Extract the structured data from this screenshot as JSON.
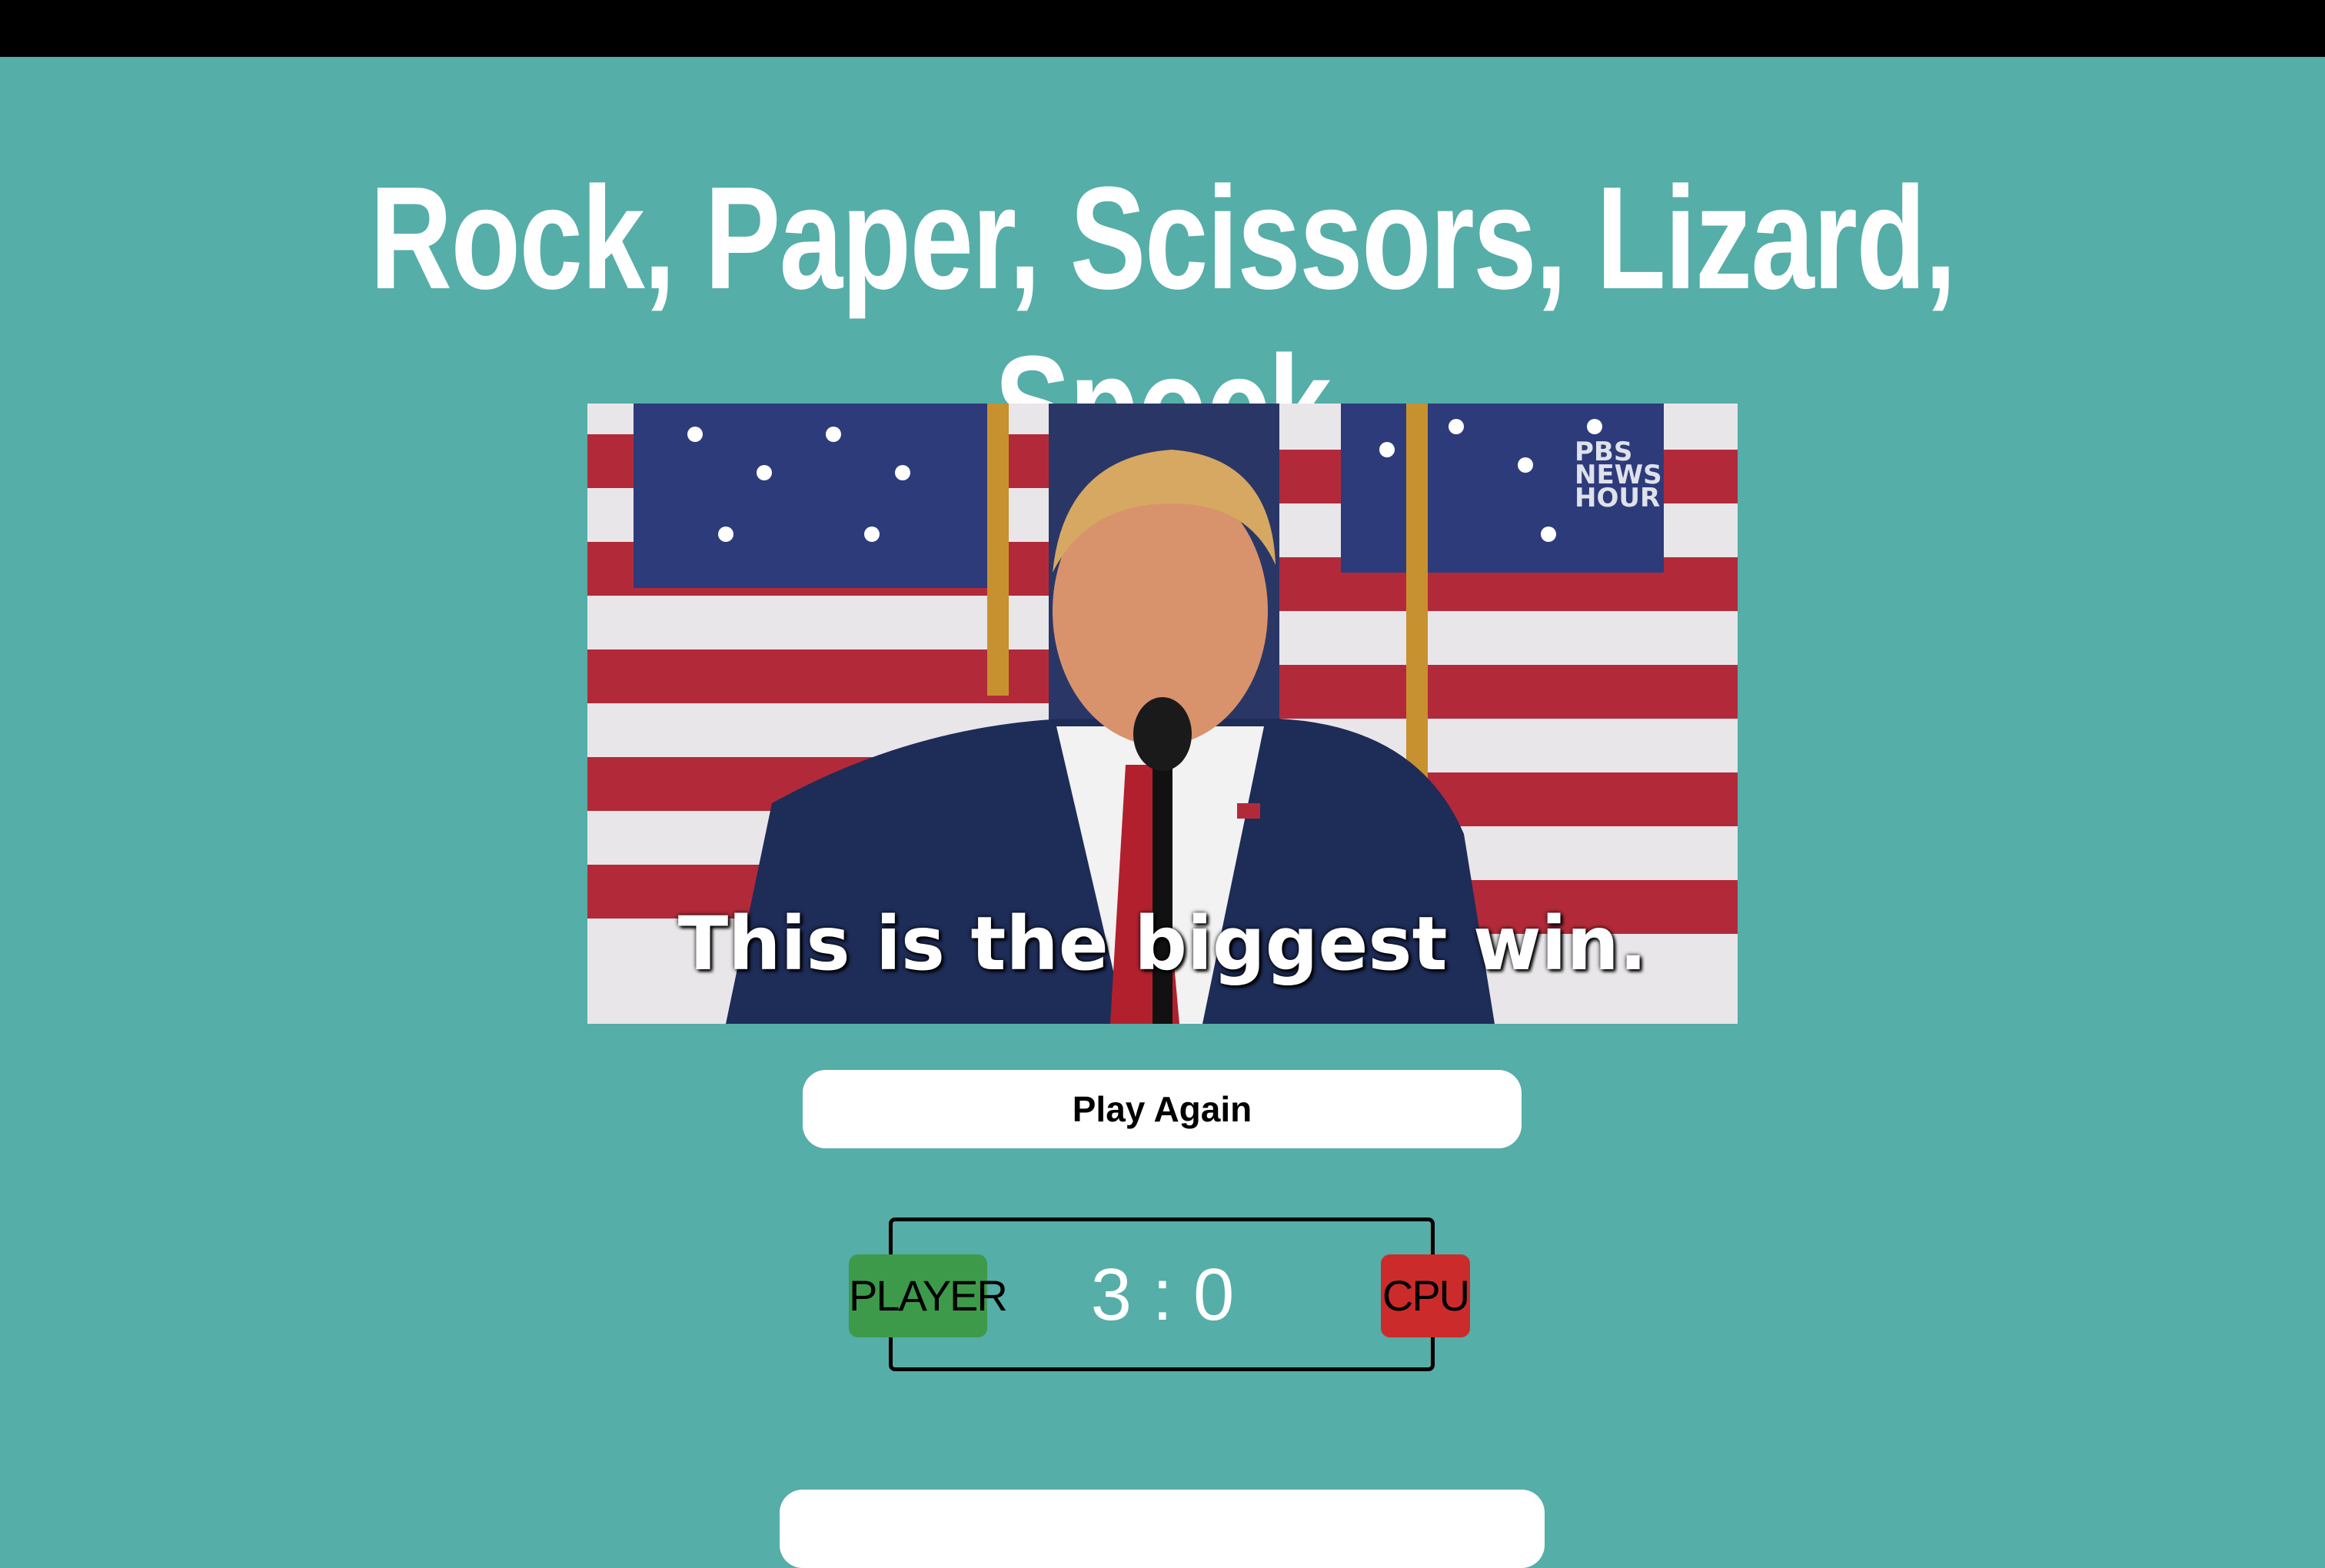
{
  "page": {
    "title": "Rock, Paper, Scissors, Lizard, Spock",
    "background_color": "#55aea8",
    "top_bar_color": "#000000"
  },
  "result_gif": {
    "caption": "This is the biggest win.",
    "watermark": "PBS NEWS HOUR"
  },
  "controls": {
    "play_again_label": "Play Again"
  },
  "scoreboard": {
    "player_label": "PLAYER",
    "cpu_label": "CPU",
    "player_score": "3",
    "separator": ":",
    "cpu_score": "0",
    "player_color": "#3d9a4b",
    "cpu_color": "#cc2b2b"
  }
}
